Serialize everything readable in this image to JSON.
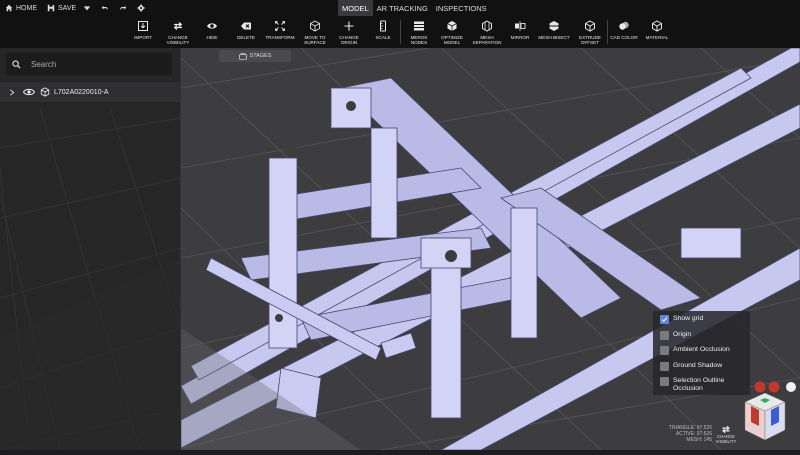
{
  "topbar": {
    "home_label": "HOME",
    "save_label": "SAVE",
    "mode_tabs": [
      {
        "label": "MODEL",
        "active": true
      },
      {
        "label": "AR TRACKING",
        "active": false
      },
      {
        "label": "INSPECTIONS",
        "active": false
      }
    ]
  },
  "toolbar": {
    "tools": [
      {
        "label": "IMPORT",
        "icon": "import-icon"
      },
      {
        "label": "CHANGE\nVISIBILITY",
        "icon": "swap-arrows-icon"
      },
      {
        "label": "HIDE",
        "icon": "eye-icon"
      },
      {
        "label": "DELETE",
        "icon": "delete-icon"
      },
      {
        "label": "TRANSFORM",
        "icon": "transform-icon"
      },
      {
        "label": "MOVE TO\nSURFACE",
        "icon": "cube-icon"
      },
      {
        "label": "CHANGE\nORIGIN",
        "icon": "plus-icon"
      },
      {
        "label": "SCALE",
        "icon": "scale-icon"
      },
      {
        "label": "MERGE\nNODES",
        "icon": "merge-icon"
      },
      {
        "label": "OPTIMIZE\nMODEL",
        "icon": "optimize-icon"
      },
      {
        "label": "MESH\nSEPARATION",
        "icon": "mesh-separation-icon"
      },
      {
        "label": "MIRROR",
        "icon": "mirror-icon"
      },
      {
        "label": "MESH BISECT",
        "icon": "bisect-icon"
      },
      {
        "label": "EXTRUDE\nOFFSET",
        "icon": "extrude-icon"
      },
      {
        "label": "CAD COLOR",
        "icon": "palette-icon"
      },
      {
        "label": "MATERIAL",
        "icon": "material-icon"
      }
    ]
  },
  "sidebar": {
    "search_placeholder": "Search",
    "tree_item_label": "L702A0220010-A"
  },
  "viewport": {
    "stages_label": "STAGES",
    "options": [
      {
        "label": "Show grid",
        "checked": true
      },
      {
        "label": "Origin",
        "checked": false
      },
      {
        "label": "Ambient Occlusion",
        "checked": false
      },
      {
        "label": "Ground Shadow",
        "checked": false
      },
      {
        "label": "Selection Outline Occlusion",
        "checked": false
      }
    ],
    "stats": {
      "triangle": "TRIANGLE: 97.526",
      "active": "ACTIVE: 97.526",
      "mesh": "MESH: 145"
    },
    "change_visibility_label": "CHANGE\nVISIBILITY",
    "viewcube": {
      "front": "FRONT",
      "right": "RIGHT",
      "top": "TOP"
    }
  },
  "colors": {
    "accent": "#5d85d9",
    "model": "#c7c8f0",
    "background": "#3d3d3f"
  }
}
